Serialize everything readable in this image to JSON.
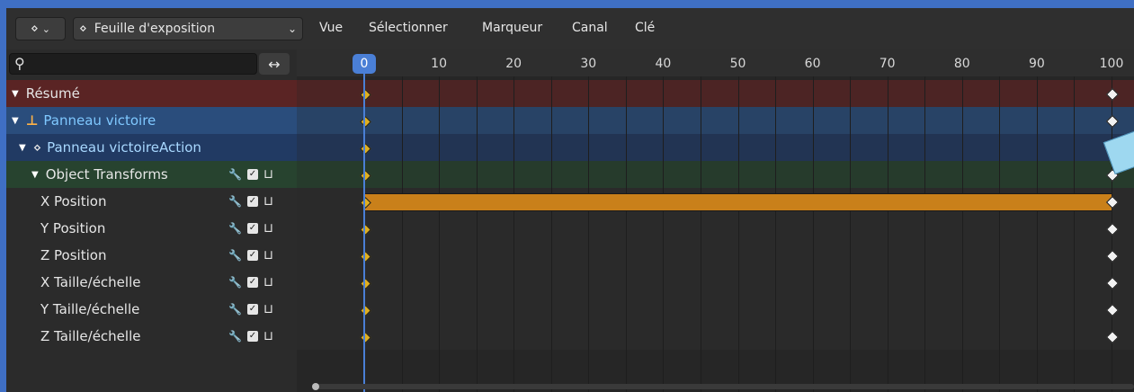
{
  "header": {
    "editor_icon": "dopesheet-editor-icon",
    "mode": {
      "label": "Feuille d'exposition",
      "icon": "dopesheet-icon"
    },
    "menus": [
      "Vue",
      "Sélectionner",
      "Marqueur",
      "Canal",
      "Clé"
    ]
  },
  "search": {
    "value": "",
    "placeholder": ""
  },
  "channels": [
    {
      "label": "Résumé",
      "level": 0,
      "expanded": true,
      "kind": "summary",
      "icons": false
    },
    {
      "label": "Panneau victoire",
      "level": 0,
      "expanded": true,
      "kind": "object",
      "icons": false
    },
    {
      "label": "Panneau victoireAction",
      "level": 1,
      "expanded": true,
      "kind": "action",
      "icons": false
    },
    {
      "label": "Object Transforms",
      "level": 2,
      "expanded": true,
      "kind": "group",
      "icons": true
    },
    {
      "label": "X Position",
      "level": 3,
      "kind": "channel",
      "icons": true
    },
    {
      "label": "Y Position",
      "level": 3,
      "kind": "channel",
      "icons": true
    },
    {
      "label": "Z Position",
      "level": 3,
      "kind": "channel",
      "icons": true
    },
    {
      "label": "X Taille/échelle",
      "level": 3,
      "kind": "channel",
      "icons": true
    },
    {
      "label": "Y Taille/échelle",
      "level": 3,
      "kind": "channel",
      "icons": true
    },
    {
      "label": "Z Taille/échelle",
      "level": 3,
      "kind": "channel",
      "icons": true
    }
  ],
  "timeline": {
    "ticks": [
      "10",
      "20",
      "30",
      "40",
      "50",
      "60",
      "70",
      "80",
      "90",
      "100"
    ],
    "current_frame": "0",
    "keyframes_at": [
      0,
      100
    ],
    "hold_row": "X Position"
  },
  "colors": {
    "summary": "#5a2424",
    "object": "#2a4d7c",
    "action": "#213a63",
    "group": "#27432f",
    "hold": "#c9801a",
    "playhead": "#4a7fd6"
  }
}
